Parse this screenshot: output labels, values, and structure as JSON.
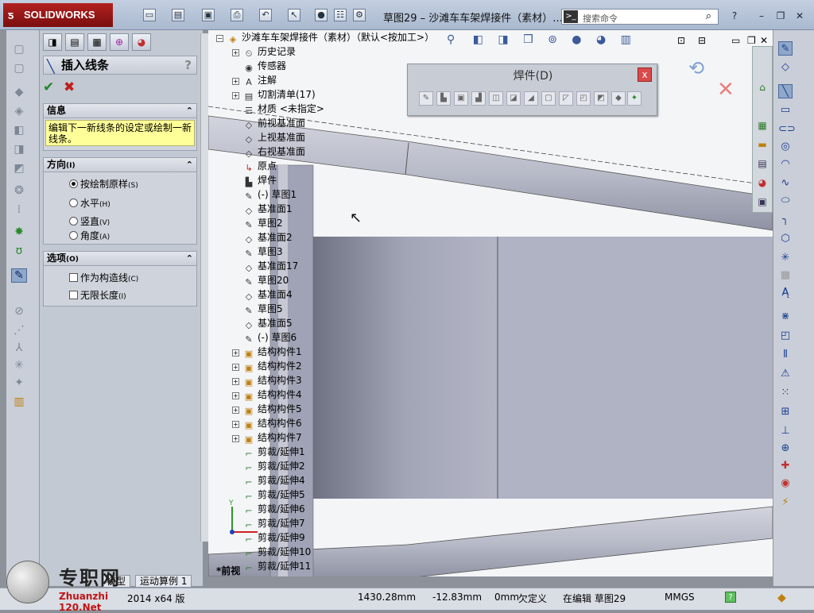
{
  "app": {
    "logo_text": "SOLIDWORKS",
    "doc_title": "草图29 – 沙滩车车架焊接件（素材）...",
    "search_placeholder": "搜索命令"
  },
  "property_manager": {
    "title": "插入线条",
    "help": "?",
    "info": {
      "header": "信息",
      "message": "编辑下一新线条的设定或绘制一新线条。"
    },
    "direction": {
      "header": "方向",
      "header_key": "(I)",
      "options": [
        {
          "label": "按绘制原样",
          "key": "(S)",
          "selected": true
        },
        {
          "label": "水平",
          "key": "(H)",
          "selected": false
        },
        {
          "label": "竖直",
          "key": "(V)",
          "selected": false
        },
        {
          "label": "角度",
          "key": "(A)",
          "selected": false
        }
      ]
    },
    "options": {
      "header": "选项",
      "header_key": "(O)",
      "items": [
        {
          "label": "作为构造线",
          "key": "(C)",
          "checked": false
        },
        {
          "label": "无限长度",
          "key": "(I)",
          "checked": false
        }
      ]
    }
  },
  "tree": {
    "root": "沙滩车车架焊接件（素材）（默认<按加工>）",
    "items": [
      "历史记录",
      "传感器",
      "注解",
      "切割清单(17)",
      "材质 <未指定>",
      "前视基准面",
      "上视基准面",
      "右视基准面",
      "原点",
      "焊件",
      "(-) 草图1",
      "基准面1",
      "草图2",
      "基准面2",
      "草图3",
      "基准面17",
      "草图20",
      "基准面4",
      "草图5",
      "基准面5",
      "(-) 草图6",
      "结构构件1",
      "结构构件2",
      "结构构件3",
      "结构构件4",
      "结构构件5",
      "结构构件6",
      "结构构件7",
      "剪裁/延伸1",
      "剪裁/延伸2",
      "剪裁/延伸4",
      "剪裁/延伸5",
      "剪裁/延伸6",
      "剪裁/延伸7",
      "剪裁/延伸9",
      "剪裁/延伸10",
      "剪裁/延伸11"
    ]
  },
  "weldments_toolbar": {
    "title": "焊件(D)",
    "close": "x"
  },
  "tabs": {
    "model": "模型",
    "motion": "运动算例 1"
  },
  "view_label": "*前视",
  "status": {
    "version": "2014 x64 版",
    "x": "1430.28mm",
    "y": "-12.83mm",
    "z": "0mm",
    "state": "欠定义",
    "editing": "在编辑 草图29",
    "units": "MMGS",
    "help": "?"
  },
  "watermark": {
    "text": "专职网",
    "url": "Zhuanzhi 120.Net"
  },
  "colors": {
    "accent_red": "#b32121",
    "ok_green": "#1e8a2b",
    "info_yellow": "#ffff99"
  }
}
